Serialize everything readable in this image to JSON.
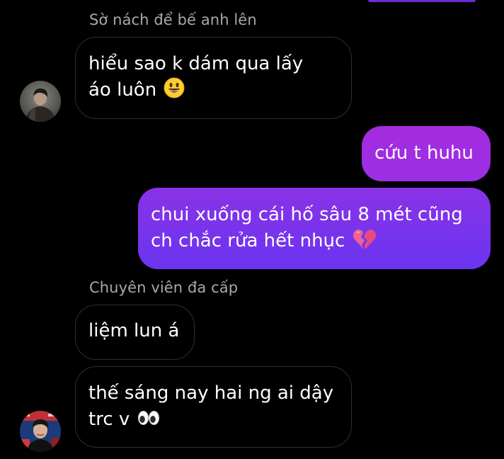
{
  "colors": {
    "background": "#000000",
    "outgoing_bubble_top": "#a52ce0",
    "outgoing_bubble_bottom": "#6a35f0",
    "incoming_border": "#2f2f2f",
    "sender_name": "#a8a8a8"
  },
  "messages": [
    {
      "direction": "incoming",
      "sender": "Sờ nách để bế anh lên",
      "lines": [
        "hiểu sao k dám qua lấy",
        "áo luôn"
      ],
      "emoji": "grinning-face-icon"
    },
    {
      "direction": "outgoing",
      "lines": [
        "cứu t huhu"
      ]
    },
    {
      "direction": "outgoing",
      "lines": [
        "chui xuống cái hố sâu 8 mét cũng",
        "ch chắc rửa hết nhục"
      ],
      "emoji": "broken-heart-icon"
    },
    {
      "direction": "incoming",
      "sender": "Chuyên viên đa cấp",
      "lines": [
        "liệm lun á"
      ]
    },
    {
      "direction": "incoming",
      "lines": [
        "thế sáng nay hai ng ai dậy",
        "trc v"
      ],
      "emoji": "eyes-icon"
    }
  ]
}
